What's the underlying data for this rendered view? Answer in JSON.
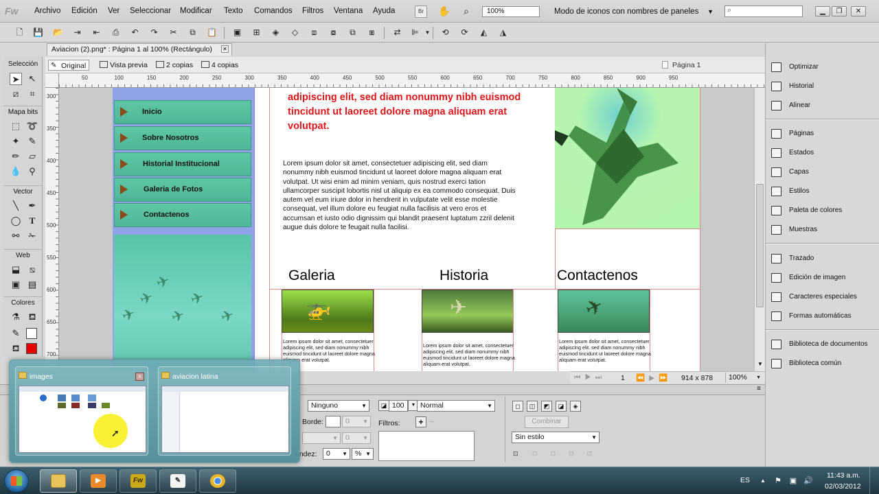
{
  "app": {
    "logo": "Fw",
    "menu": [
      "Archivo",
      "Edición",
      "Ver",
      "Seleccionar",
      "Modificar",
      "Texto",
      "Comandos",
      "Filtros",
      "Ventana",
      "Ayuda"
    ],
    "bridge_label": "Br",
    "zoom": "100%",
    "workspace": "Modo de iconos con nombres de paneles"
  },
  "document": {
    "tab_title": "Aviacion (2).png* : Página 1 al 100% (Rectángulo)",
    "views": [
      "Original",
      "Vista previa",
      "2 copias",
      "4 copias"
    ],
    "page": "Página 1",
    "ruler_h": [
      "50",
      "100",
      "150",
      "200",
      "250",
      "300",
      "350",
      "400",
      "450",
      "500",
      "550",
      "600",
      "650",
      "700",
      "750",
      "800",
      "850",
      "900",
      "950"
    ],
    "ruler_v": [
      "300",
      "350",
      "400",
      "450",
      "500",
      "550",
      "600",
      "650",
      "700"
    ],
    "page_number": "1",
    "size": "914 x 878",
    "zoom": "100%"
  },
  "tools": {
    "sections": [
      "Selección",
      "Mapa bits",
      "Vector",
      "Web",
      "Colores"
    ],
    "stroke_color": "#ffffff",
    "fill_color": "#e60000"
  },
  "design": {
    "nav": [
      "Inicio",
      "Sobre Nosotros",
      "Historial Institucional",
      "Galeria de Fotos",
      "Contactenos"
    ],
    "hero": "adipiscing elit, sed diam nonummy nibh euismod tincidunt ut laoreet dolore magna aliquam erat volutpat.",
    "body": "Lorem ipsum dolor sit amet, consectetuer adipiscing elit, sed diam nonummy nibh euismod tincidunt ut laoreet dolore magna aliquam erat volutpat. Ut wisi enim ad minim veniam, quis nostrud exerci tation ullamcorper suscipit lobortis nisl ut aliquip ex ea commodo consequat. Duis autem vel eum iriure dolor in hendrerit in vulputate velit esse molestie consequat, vel illum dolore eu feugiat nulla facilisis at vero eros et accumsan et iusto odio dignissim qui blandit praesent luptatum zzril delenit augue duis dolore te feugait nulla facilisi.",
    "sections": [
      "Galeria",
      "Historia",
      "Contactenos"
    ],
    "card_text": "Lorem ipsum dolor sit amet, consectetuer adipiscing elit, sed diam nonummy nibh euismod tincidunt ut laoreet dolore magna aliquam erat volutpat."
  },
  "properties": {
    "blend_none": "Ninguno",
    "opacity": "100",
    "blend_mode": "Normal",
    "border_label": "Borde:",
    "border_value": "0",
    "filters_label": "Filtros:",
    "round_label": "ondez:",
    "round_value": "0",
    "round_unit": "%",
    "combine": "Combinar",
    "style": "Sin estilo",
    "disabled_value": "0"
  },
  "panels": {
    "group1": [
      "Optimizar",
      "Historial",
      "Alinear"
    ],
    "group2": [
      "Páginas",
      "Estados",
      "Capas",
      "Estilos",
      "Paleta de colores",
      "Muestras"
    ],
    "group3": [
      "Trazado",
      "Edición de imagen",
      "Caracteres especiales",
      "Formas automáticas"
    ],
    "group4": [
      "Biblioteca de documentos",
      "Biblioteca común"
    ]
  },
  "aero": {
    "windows": [
      "images",
      "aviacion latina"
    ],
    "close": "x"
  },
  "taskbar": {
    "fw_label": "Fw",
    "lang": "ES",
    "time": "11:43 a.m.",
    "date": "02/03/2012"
  }
}
